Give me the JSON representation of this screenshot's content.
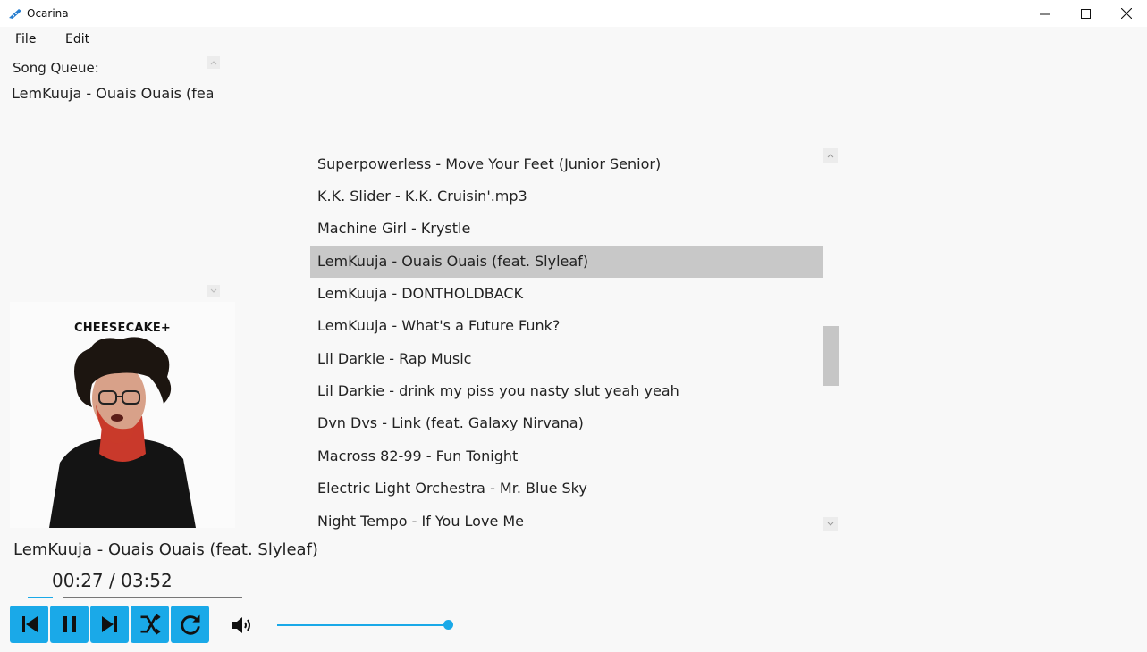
{
  "window": {
    "title": "Ocarina",
    "icon": "ocarina-icon"
  },
  "menu": {
    "file": "File",
    "edit": "Edit"
  },
  "queue": {
    "label": "Song Queue:",
    "items": [
      "LemKuuja - Ouais Ouais (feat"
    ]
  },
  "album": {
    "text": "CHEESECAKE+"
  },
  "now_playing": {
    "title": "LemKuuja - Ouais Ouais (feat. Slyleaf)",
    "time": "00:27 / 03:52",
    "progress": 0.12
  },
  "controls": {
    "previous": "skip-previous-icon",
    "pause": "pause-icon",
    "next": "skip-next-icon",
    "shuffle": "shuffle-icon",
    "repeat": "repeat-icon",
    "volume_icon": "volume-icon",
    "volume": 1.0
  },
  "playlist": {
    "items": [
      "Superpowerless - Move Your Feet (Junior Senior)",
      "K.K. Slider - K.K. Cruisin'.mp3",
      "Machine Girl - Krystle",
      "LemKuuja - Ouais Ouais (feat. Slyleaf)",
      "LemKuuja - DONTHOLDBACK",
      "LemKuuja - What's a Future Funk?",
      "Lil Darkie - Rap Music",
      "Lil Darkie - drink my piss you nasty slut yeah yeah",
      "Dvn Dvs - Link (feat. Galaxy Nirvana)",
      "Macross 82-99 - Fun Tonight",
      "Electric Light Orchestra - Mr. Blue Sky",
      "Night Tempo - If You Love Me"
    ],
    "selected_index": 3
  },
  "colors": {
    "accent": "#1aa9e8",
    "selected_row": "#c8c8c8",
    "background": "#f8f8f8"
  }
}
